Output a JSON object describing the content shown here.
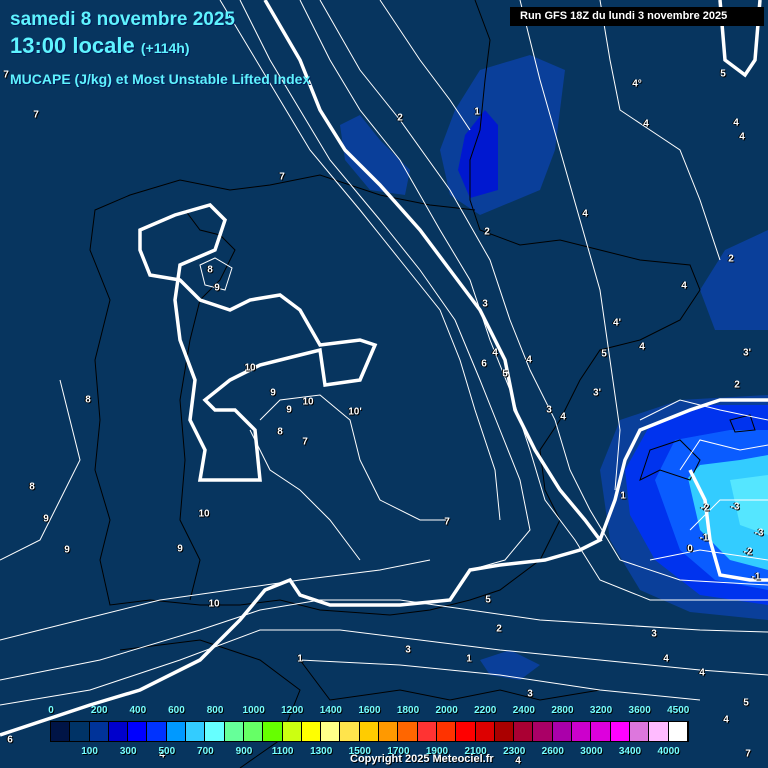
{
  "header": {
    "date": "samedi 8 novembre 2025",
    "time": "13:00 locale",
    "lead": "(+114h)",
    "parameter": "MUCAPE (J/kg) et Most Unstable Lifted Index",
    "run": "Run GFS 18Z du lundi 3 novembre 2025"
  },
  "legend": {
    "top_ticks": [
      "0",
      "200",
      "400",
      "600",
      "800",
      "1000",
      "1200",
      "1400",
      "1600",
      "1800",
      "2000",
      "2200",
      "2400",
      "2800",
      "3200",
      "3600",
      "4500"
    ],
    "bottom_ticks": [
      "100",
      "300",
      "500",
      "700",
      "900",
      "1100",
      "1300",
      "1500",
      "1700",
      "1900",
      "2100",
      "2300",
      "2600",
      "3000",
      "3400",
      "4000"
    ],
    "colors": [
      "#001446",
      "#003366",
      "#003399",
      "#0000cc",
      "#0000ff",
      "#0033ff",
      "#0099ff",
      "#33ccff",
      "#66ffff",
      "#66ff99",
      "#66ff66",
      "#66ff00",
      "#ccff11",
      "#ffff00",
      "#ffff88",
      "#ffe44c",
      "#ffcc00",
      "#ff9900",
      "#ff6600",
      "#ff3333",
      "#ff3300",
      "#ff0000",
      "#dd0000",
      "#aa0000",
      "#aa0033",
      "#aa0066",
      "#aa00aa",
      "#cc00cc",
      "#dd00dd",
      "#ff00ff",
      "#dd77dd",
      "#ffbbff",
      "#ffffff"
    ]
  },
  "lifted_index_labels": [
    "7",
    "7",
    "2",
    "1",
    "4°",
    "4",
    "5",
    "4",
    "4",
    "7",
    "4",
    "2",
    "2",
    "4",
    "8",
    "9",
    "3",
    "4'",
    "5",
    "4",
    "3'",
    "4",
    "4",
    "6",
    "5",
    "10",
    "2",
    "3'",
    "9",
    "8",
    "10",
    "9",
    "10'",
    "3",
    "4",
    "8",
    "7",
    "1",
    "8",
    "10",
    "9",
    "-2",
    "-3",
    "-3",
    "-1",
    "-2",
    "0",
    "-1",
    "9",
    "9",
    "7",
    "5",
    "10",
    "2",
    "3",
    "3",
    "1",
    "1",
    "4",
    "4",
    "3",
    "5",
    "4",
    "6",
    "7",
    "4",
    "4"
  ],
  "copyright": "Copyright 2025 Meteociel.fr"
}
